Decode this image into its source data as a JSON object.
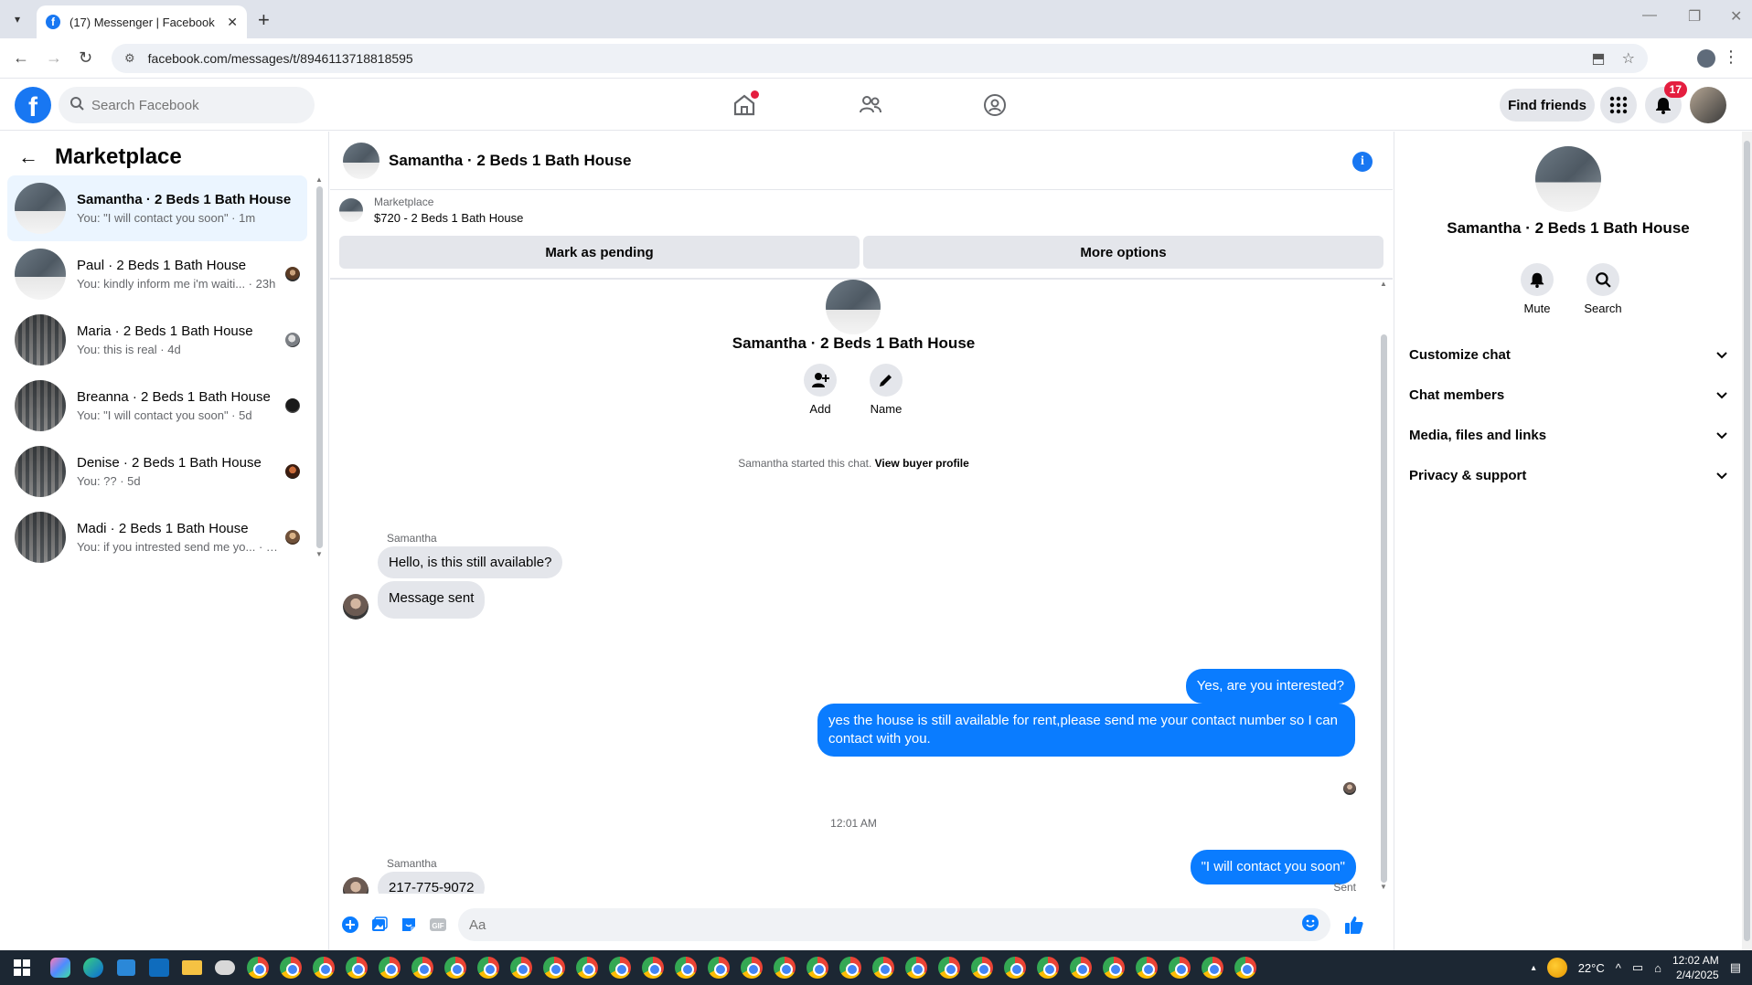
{
  "browser": {
    "tab_title": "(17) Messenger | Facebook",
    "url": "facebook.com/messages/t/8946113718818595"
  },
  "fb": {
    "logo": "f",
    "search_placeholder": "Search Facebook",
    "find_friends": "Find friends",
    "notif_count": "17"
  },
  "sidebar": {
    "title": "Marketplace",
    "conversations": [
      {
        "name": "Samantha · 2 Beds 1 Bath House",
        "preview": "You: \"I will contact you soon\" · 1m",
        "active": true
      },
      {
        "name": "Paul · 2 Beds 1 Bath House",
        "preview": "You: kindly inform me i'm waiti... · 23h"
      },
      {
        "name": "Maria · 2 Beds 1 Bath House",
        "preview": "You: this is real · 4d"
      },
      {
        "name": "Breanna · 2 Beds 1 Bath House",
        "preview": "You: \"I will contact you soon\" · 5d"
      },
      {
        "name": "Denise · 2 Beds 1 Bath House",
        "preview": "You: ?? · 5d"
      },
      {
        "name": "Madi · 2 Beds 1 Bath House",
        "preview": "You: if you intrested send me yo... · 6d"
      }
    ]
  },
  "chat": {
    "title": "Samantha · 2 Beds 1 Bath House",
    "marketplace_label": "Marketplace",
    "listing": "$720 - 2 Beds 1 Bath House",
    "mark_pending": "Mark as pending",
    "more_options": "More options",
    "center_name": "Samantha · 2 Beds 1 Bath House",
    "add_label": "Add",
    "name_label": "Name",
    "started_text": "Samantha started this chat.",
    "view_buyer": "View buyer profile",
    "sender_name": "Samantha",
    "messages": {
      "in1": "Hello, is this still available?",
      "in2": "Message sent",
      "out1": "Yes, are you interested?",
      "out2": "yes the house is still available for rent,please send me your contact number so I can contact with you.",
      "in3": "217-775-9072",
      "out3": "\"I will contact you soon\""
    },
    "time": "12:01 AM",
    "sent": "Sent",
    "composer_placeholder": "Aa"
  },
  "right_panel": {
    "name": "Samantha · 2 Beds 1 Bath House",
    "mute": "Mute",
    "search": "Search",
    "sections": [
      "Customize chat",
      "Chat members",
      "Media, files and links",
      "Privacy & support"
    ]
  },
  "taskbar": {
    "temp": "22°C",
    "time": "12:02 AM",
    "date": "2/4/2025"
  }
}
